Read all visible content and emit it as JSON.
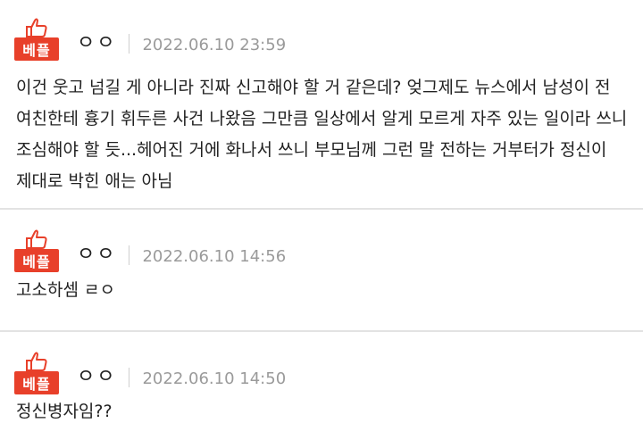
{
  "comments": [
    {
      "badge": "베플",
      "author": "ㅇㅇ",
      "date": "2022.06.10 23:59",
      "text": "이건 웃고 넘길 게 아니라 진짜 신고해야 할 거 같은데? 엊그제도 뉴스에서 남성이 전 여친한테 흉기 휘두른 사건 나왔음 그만큼 일상에서 알게 모르게 자주 있는 일이라 쓰니 조심해야 할 듯...헤어진 거에 화나서 쓰니 부모님께 그런 말 전하는 거부터가 정신이 제대로 박힌 애는 아님"
    },
    {
      "badge": "베플",
      "author": "ㅇㅇ",
      "date": "2022.06.10 14:56",
      "text": "고소하셈 ㄹㅇ"
    },
    {
      "badge": "베플",
      "author": "ㅇㅇ",
      "date": "2022.06.10 14:50",
      "text": "정신병자임??"
    }
  ],
  "colors": {
    "badge_bg": "#e8402a",
    "date_text": "#9a9a9a",
    "divider": "#e3e3e3"
  },
  "icons": {
    "thumb": "thumbs-up-icon"
  }
}
